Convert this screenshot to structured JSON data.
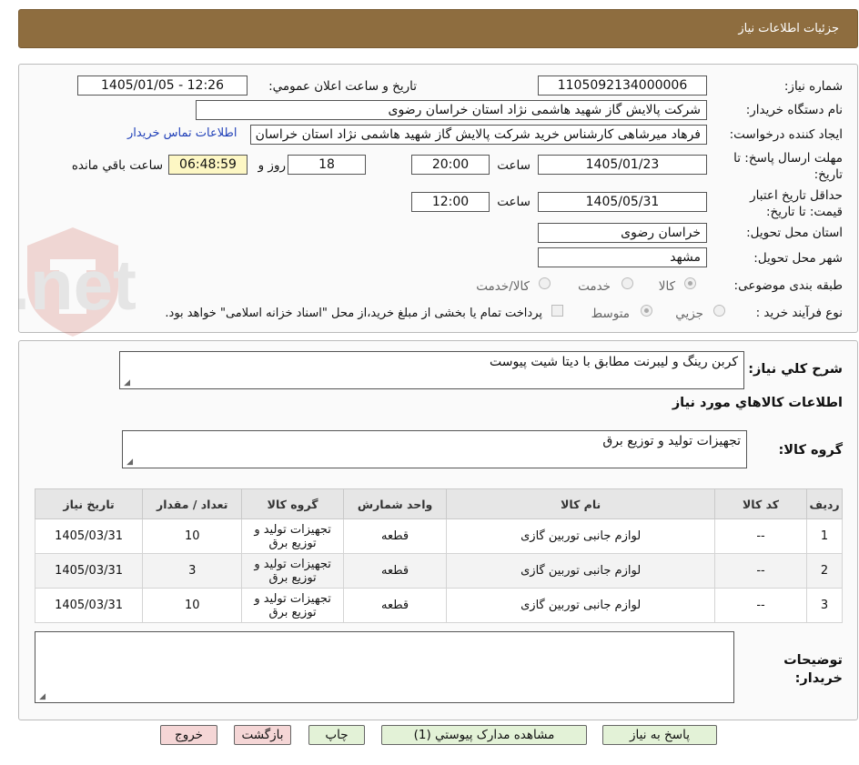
{
  "header": {
    "title": "جزئيات اطلاعات نياز"
  },
  "form": {
    "need_number_label": "شماره نیاز:",
    "need_number": "1105092134000006",
    "announce_label": "تاریخ و ساعت اعلان عمومي:",
    "announce_value": "1405/01/05 - 12:26",
    "buyer_org_label": "نام دستگاه خریدار:",
    "buyer_org": "شرکت پالایش گاز شهید هاشمی نژاد   استان خراسان رضوی",
    "requester_label": "ایجاد کننده درخواست:",
    "requester": "فرهاد میرشاهی کارشناس خرید شرکت پالایش گاز شهید هاشمی نژاد   استان خراسان رضوی",
    "contact_link": "اطلاعات تماس خریدار",
    "deadline_label": "مهلت ارسال پاسخ: تا تاریخ:",
    "deadline_date": "1405/01/23",
    "time_label": "ساعت",
    "deadline_time": "20:00",
    "days_value": "18",
    "days_label": "روز و",
    "remaining_time": "06:48:59",
    "remaining_label": "ساعت باقي مانده",
    "validity_label": "حداقل تاریخ اعتبار قیمت: تا تاریخ:",
    "validity_date": "1405/05/31",
    "validity_time": "12:00",
    "province_label": "استان محل تحویل:",
    "province": "خراسان رضوی",
    "city_label": "شهر محل تحویل:",
    "city": "مشهد",
    "category_label": "طبقه بندی موضوعی:",
    "category_options": [
      "کالا",
      "خدمت",
      "کالا/خدمت"
    ],
    "process_label": "نوع فرآیند خرید :",
    "process_options": [
      "جزیي",
      "متوسط"
    ],
    "payment_note": "پرداخت تمام یا بخشی از مبلغ خرید،از محل \"اسناد خزانه اسلامی\" خواهد بود."
  },
  "description": {
    "label": "شرح کلي نياز:",
    "text": "کربن رینگ و لیبرنت مطابق با دیتا شیت پیوست"
  },
  "goods": {
    "section_title": "اطلاعات کالاهاي مورد نياز",
    "group_label": "گروه کالا:",
    "group_value": "تجهیزات تولید و توزیع برق"
  },
  "table": {
    "headers": [
      "ردیف",
      "کد کالا",
      "نام کالا",
      "واحد شمارش",
      "گروه کالا",
      "تعداد / مقدار",
      "تاریخ نیاز"
    ],
    "rows": [
      [
        "1",
        "--",
        "لوازم جانبی توربین گازی",
        "قطعه",
        "تجهیزات تولید و توزیع برق",
        "10",
        "1405/03/31"
      ],
      [
        "2",
        "--",
        "لوازم جانبی توربین گازی",
        "قطعه",
        "تجهیزات تولید و توزیع برق",
        "3",
        "1405/03/31"
      ],
      [
        "3",
        "--",
        "لوازم جانبی توربین گازی",
        "قطعه",
        "تجهیزات تولید و توزیع برق",
        "10",
        "1405/03/31"
      ]
    ]
  },
  "buyer_notes": {
    "label": "توضیحات خریدار:",
    "text": ""
  },
  "buttons": {
    "reply": "پاسخ به نياز",
    "attachments": "مشاهده مدارک پيوستي (1)",
    "print": "چاپ",
    "back": "بازگشت",
    "exit": "خروج"
  },
  "watermark": {
    "text": "AriaTender.net"
  },
  "colors": {
    "header_bg": "#8e6d3f",
    "link": "#1f3fb8",
    "highlight": "#fdf7c4"
  }
}
